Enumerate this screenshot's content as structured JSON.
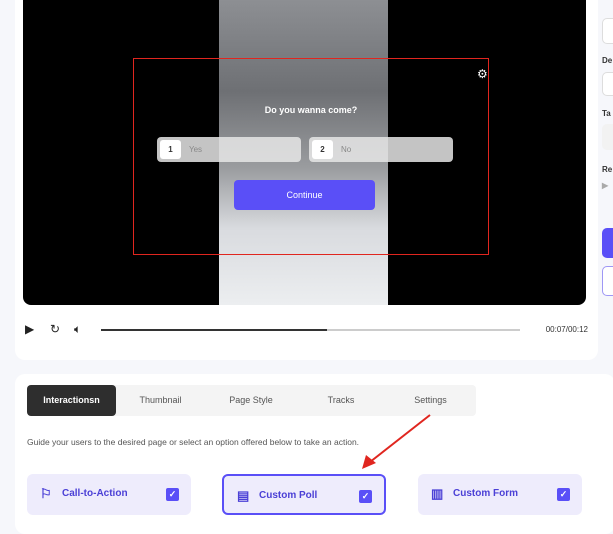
{
  "player": {
    "poll_question": "Do you wanna come?",
    "options": [
      {
        "num": "1",
        "label": "Yes"
      },
      {
        "num": "2",
        "label": "No"
      }
    ],
    "continue_label": "Continue",
    "time": "00:07/00:12",
    "progress_percent": 54
  },
  "right_panel": {
    "labels": [
      "De",
      "Ta",
      "Re"
    ]
  },
  "tabs": [
    "Interactionsn",
    "Thumbnail",
    "Page Style",
    "Tracks",
    "Settings"
  ],
  "active_tab": "Interactionsn",
  "description": "Guide your users to the desired page or select an option offered below to take an action.",
  "interaction_types": [
    {
      "label": "Call-to-Action",
      "icon": "flag-icon",
      "checked": true
    },
    {
      "label": "Custom Poll",
      "icon": "poll-icon",
      "checked": true,
      "selected": true
    },
    {
      "label": "Custom Form",
      "icon": "form-icon",
      "checked": true
    }
  ],
  "colors": {
    "accent": "#5a4ff7",
    "highlight": "#e0261f"
  }
}
